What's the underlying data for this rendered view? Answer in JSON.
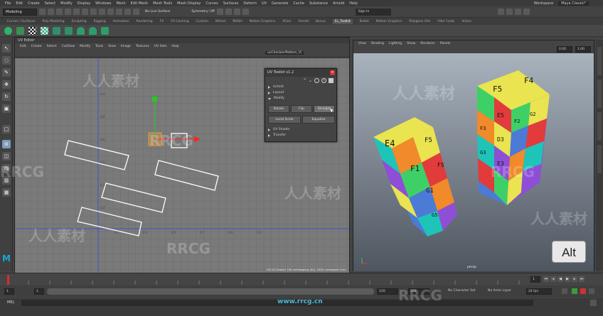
{
  "menu": {
    "items": [
      "File",
      "Edit",
      "Create",
      "Select",
      "Modify",
      "Display",
      "Windows",
      "Mesh",
      "Edit Mesh",
      "Mesh Tools",
      "Mesh Display",
      "Curves",
      "Surfaces",
      "Deform",
      "UV",
      "Generate",
      "Cache",
      "Substance",
      "Arnold",
      "Help"
    ],
    "workspace_label": "Workspace",
    "workspace_value": "Maya Classic*"
  },
  "status_line": {
    "mode": "Modeling",
    "live_surface": "No Live Surface",
    "symmetry": "Symmetry: Off",
    "sign_in": "Sign In"
  },
  "shelf": {
    "tabs": [
      "Curves / Surfaces",
      "Poly Modeling",
      "Sculpting",
      "Rigging",
      "Animation",
      "Rendering",
      "FX",
      "FX Caching",
      "Custom",
      "Bifrost",
      "MASH",
      "Motion Graphics",
      "XGen",
      "Arnold",
      "Bonus",
      "EL_Toolkit",
      "Bullet",
      "Motion Graphics",
      "Polygons UVs",
      "Vibe Cooki",
      "Vision"
    ],
    "active_tab": "EL_Toolkit"
  },
  "uv_editor": {
    "title": "UV Editor",
    "menu": [
      "Edit",
      "Create",
      "Select",
      "Cut/Sew",
      "Modify",
      "Tools",
      "View",
      "Image",
      "Textures",
      "UV Sets",
      "Help"
    ],
    "uv_set": "uvChecker/Pattern_Vi",
    "footer": "100.00 (black) 100 overlapping (0x), 1000 unmapped (1m)",
    "axis_labels": [
      "1.0",
      "0.9",
      "0.8",
      "0.7",
      "0.6",
      "0.5",
      "0.4",
      "0.3",
      "0.2",
      "0.1",
      "0.0",
      "0.1",
      "0.2",
      "0.3",
      "0.4",
      "0.5",
      "0.6",
      "0.7",
      "0.8",
      "0.9",
      "1.0"
    ]
  },
  "uv_toolkit": {
    "title": "UV Toolkit v1.2",
    "sections": [
      "Unfold",
      "Layout",
      "Modify",
      "UV Shader",
      "Transfer"
    ],
    "buttons": [
      "Rotate",
      "Flip",
      "Straight",
      "Local Scale",
      "Equalize"
    ]
  },
  "viewport": {
    "menu": [
      "View",
      "Shading",
      "Lighting",
      "Show",
      "Renderer",
      "Panels"
    ],
    "field_a": "0.00",
    "field_b": "1.00",
    "camera_label": "persp",
    "face_labels": [
      "E4",
      "F5",
      "F4",
      "G5",
      "E5",
      "G4",
      "D3",
      "E3",
      "F3",
      "G3",
      "F2",
      "G2",
      "E4",
      "F1",
      "G1",
      "F5",
      "G5"
    ]
  },
  "alt_badge": "Alt",
  "timeline": {
    "start": "1",
    "end": "120",
    "range_start": "1",
    "range_end": "120",
    "anim_end": "200",
    "current": "1",
    "ticks": [
      "5",
      "10",
      "15",
      "20",
      "25",
      "30",
      "35",
      "40",
      "45",
      "50",
      "55",
      "60",
      "65",
      "70",
      "75",
      "80",
      "85",
      "90",
      "95",
      "100",
      "105",
      "110",
      "115",
      "120"
    ]
  },
  "range_bar": {
    "char_set": "No Character Set",
    "anim_layer": "No Anim Layer",
    "fps": "24 fps"
  },
  "command_line": {
    "label": "MEL"
  },
  "watermarks": [
    "人人素材",
    "RRCG",
    "人人素材",
    "RRCG",
    "人人素材",
    "RRCG",
    "人人素材",
    "RRCG",
    "人人素材",
    "RRCG",
    "www.rrcg.cn"
  ],
  "colors": {
    "maya_bg": "#444444",
    "uv_grid": "#7a7a7a",
    "handle_red": "#ff2222",
    "handle_green": "#22cc22"
  }
}
